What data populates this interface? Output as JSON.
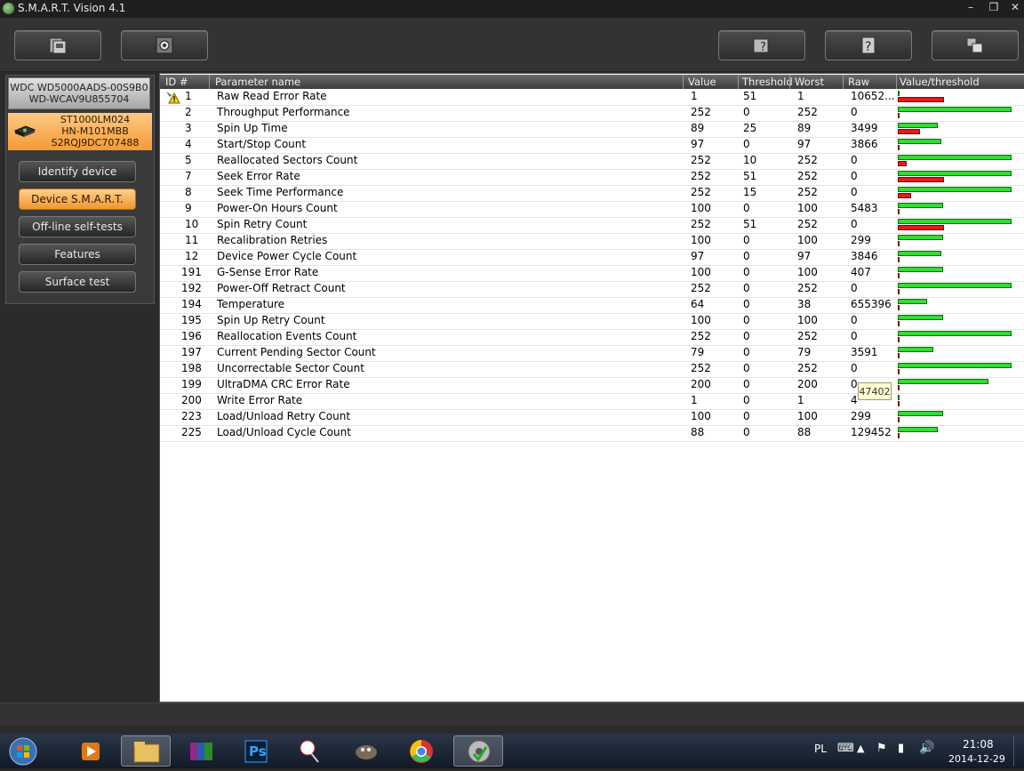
{
  "window": {
    "title": "S.M.A.R.T. Vision 4.1",
    "minimize_icon": "minimize-icon",
    "restore_icon": "restore-icon",
    "close_icon": "close-icon"
  },
  "toolbar": {
    "left_buttons": [
      "save-report-icon",
      "settings-icon"
    ],
    "right_buttons": [
      "help-book-icon",
      "question-mark-icon",
      "window-switch-icon"
    ]
  },
  "devices": [
    {
      "lines": [
        "WDC WD5000AADS-00S9B0",
        "WD-WCAV9U855704"
      ]
    },
    {
      "lines": [
        "ST1000LM024",
        "HN-M101MBB",
        "S2RQJ9DC707488"
      ],
      "selected": true
    }
  ],
  "nav": {
    "items": [
      "Identify device",
      "Device S.M.A.R.T.",
      "Off-line self-tests",
      "Features",
      "Surface test"
    ],
    "active": "Device S.M.A.R.T."
  },
  "table": {
    "headers": [
      "ID #",
      "Parameter name",
      "Value",
      "Threshold",
      "Worst",
      "Raw",
      "Value/threshold"
    ],
    "rows": [
      {
        "id": "1",
        "name": "Raw Read Error Rate",
        "value": "1",
        "threshold": "51",
        "worst": "1",
        "raw": "10652...",
        "bar_value": 0,
        "bar_threshold": 51,
        "warning": true
      },
      {
        "id": "2",
        "name": "Throughput Performance",
        "value": "252",
        "threshold": "0",
        "worst": "252",
        "raw": "0",
        "bar_value": 252,
        "bar_threshold": 0
      },
      {
        "id": "3",
        "name": "Spin Up Time",
        "value": "89",
        "threshold": "25",
        "worst": "89",
        "raw": "3499",
        "bar_value": 89,
        "bar_threshold": 25
      },
      {
        "id": "4",
        "name": "Start/Stop Count",
        "value": "97",
        "threshold": "0",
        "worst": "97",
        "raw": "3866",
        "bar_value": 97,
        "bar_threshold": 0
      },
      {
        "id": "5",
        "name": "Reallocated Sectors Count",
        "value": "252",
        "threshold": "10",
        "worst": "252",
        "raw": "0",
        "bar_value": 252,
        "bar_threshold": 10
      },
      {
        "id": "7",
        "name": "Seek Error Rate",
        "value": "252",
        "threshold": "51",
        "worst": "252",
        "raw": "0",
        "bar_value": 252,
        "bar_threshold": 51
      },
      {
        "id": "8",
        "name": "Seek Time Performance",
        "value": "252",
        "threshold": "15",
        "worst": "252",
        "raw": "0",
        "bar_value": 252,
        "bar_threshold": 15
      },
      {
        "id": "9",
        "name": "Power-On Hours Count",
        "value": "100",
        "threshold": "0",
        "worst": "100",
        "raw": "5483",
        "bar_value": 100,
        "bar_threshold": 0
      },
      {
        "id": "10",
        "name": "Spin Retry Count",
        "value": "252",
        "threshold": "51",
        "worst": "252",
        "raw": "0",
        "bar_value": 252,
        "bar_threshold": 51
      },
      {
        "id": "11",
        "name": "Recalibration Retries",
        "value": "100",
        "threshold": "0",
        "worst": "100",
        "raw": "299",
        "bar_value": 100,
        "bar_threshold": 0
      },
      {
        "id": "12",
        "name": "Device Power Cycle Count",
        "value": "97",
        "threshold": "0",
        "worst": "97",
        "raw": "3846",
        "bar_value": 97,
        "bar_threshold": 0
      },
      {
        "id": "191",
        "name": "G-Sense Error Rate",
        "value": "100",
        "threshold": "0",
        "worst": "100",
        "raw": "407",
        "bar_value": 100,
        "bar_threshold": 0
      },
      {
        "id": "192",
        "name": "Power-Off Retract Count",
        "value": "252",
        "threshold": "0",
        "worst": "252",
        "raw": "0",
        "bar_value": 252,
        "bar_threshold": 0
      },
      {
        "id": "194",
        "name": "Temperature",
        "value": "64",
        "threshold": "0",
        "worst": "38",
        "raw": "655396",
        "bar_value": 64,
        "bar_threshold": 0
      },
      {
        "id": "195",
        "name": "Spin Up Retry Count",
        "value": "100",
        "threshold": "0",
        "worst": "100",
        "raw": "0",
        "bar_value": 100,
        "bar_threshold": 0
      },
      {
        "id": "196",
        "name": "Reallocation Events Count",
        "value": "252",
        "threshold": "0",
        "worst": "252",
        "raw": "0",
        "bar_value": 252,
        "bar_threshold": 0
      },
      {
        "id": "197",
        "name": "Current Pending Sector Count",
        "value": "79",
        "threshold": "0",
        "worst": "79",
        "raw": "3591",
        "bar_value": 79,
        "bar_threshold": 0
      },
      {
        "id": "198",
        "name": "Uncorrectable Sector Count",
        "value": "252",
        "threshold": "0",
        "worst": "252",
        "raw": "0",
        "bar_value": 252,
        "bar_threshold": 0
      },
      {
        "id": "199",
        "name": "UltraDMA CRC Error Rate",
        "value": "200",
        "threshold": "0",
        "worst": "200",
        "raw": "0",
        "bar_value": 200,
        "bar_threshold": 0
      },
      {
        "id": "200",
        "name": "Write Error Rate",
        "value": "1",
        "threshold": "0",
        "worst": "1",
        "raw": "4",
        "bar_value": 0,
        "bar_threshold": 0
      },
      {
        "id": "223",
        "name": "Load/Unload Retry Count",
        "value": "100",
        "threshold": "0",
        "worst": "100",
        "raw": "299",
        "bar_value": 100,
        "bar_threshold": 0
      },
      {
        "id": "225",
        "name": "Load/Unload Cycle Count",
        "value": "88",
        "threshold": "0",
        "worst": "88",
        "raw": "129452",
        "bar_value": 88,
        "bar_threshold": 0
      }
    ],
    "bar_max": 252,
    "tooltip": "47402",
    "colors": {
      "value_bar": "#2ee02e",
      "threshold_bar": "#e81818"
    }
  },
  "taskbar": {
    "apps": [
      "start-orb-icon",
      "media-player-icon",
      "file-explorer-icon",
      "winrar-icon",
      "photoshop-icon",
      "snipping-tool-icon",
      "gimp-icon",
      "chrome-icon",
      "smart-vision-icon"
    ],
    "photoshop_label": "Ps",
    "language": "PL",
    "time": "21:08",
    "date": "2014-12-29"
  }
}
